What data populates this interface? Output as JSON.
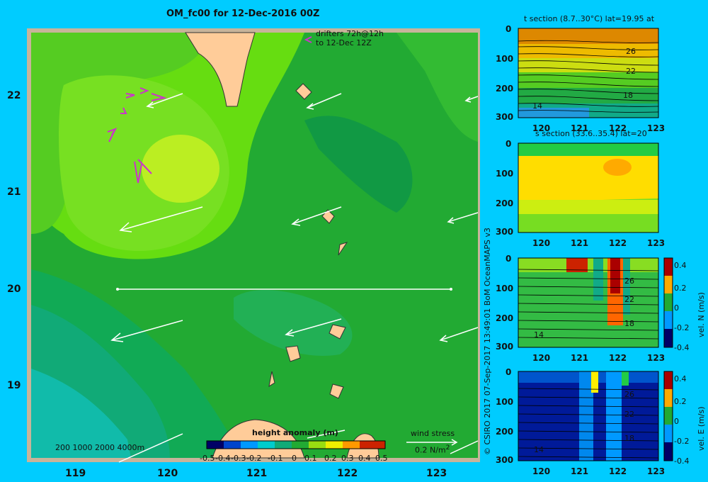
{
  "map": {
    "title": "OM_fc00 for 12-Dec-2016 00Z",
    "lon_ticks": [
      "119",
      "120",
      "121",
      "122",
      "123"
    ],
    "lat_ticks": [
      "22",
      "21",
      "20",
      "19"
    ],
    "drifters_line1": "drifters 72h@12h",
    "drifters_line2": "to 12-Dec 12Z",
    "depth_contours": "200  1000  2000  4000m",
    "wind_stress_label": "wind stress",
    "wind_stress_value": "0.2 N/m",
    "wind_stress_sup": "2",
    "colorbar_title": "height anomaly  (m)",
    "colorbar_ticks": [
      "-0.5",
      "-0.4",
      "-0.3",
      "-0.2",
      "-0.1",
      "0",
      "0.1",
      "0.2",
      "0.3",
      "0.4",
      "0.5"
    ],
    "credit": "© CSIRO 2017   07-Sep-2017 13:49:01 BoM OceanMAPS v3",
    "colors": {
      "background": "#00ccff",
      "land": "#ffcc99",
      "frame": "#c8b49a",
      "drifter": "#cc33cc",
      "arrow": "#ffffff"
    }
  },
  "panels": [
    {
      "title": "t section (8.7..30°C) lat=19.95 at",
      "x_ticks": [
        "120",
        "121",
        "122",
        "123"
      ],
      "y_ticks": [
        "0",
        "100",
        "200",
        "300"
      ],
      "contour_labels": [
        "26",
        "22",
        "18",
        "14"
      ]
    },
    {
      "title": "s section (33.6..35.4) lat=20",
      "x_ticks": [
        "120",
        "121",
        "122",
        "123"
      ],
      "y_ticks": [
        "0",
        "100",
        "200",
        "300"
      ]
    },
    {
      "title": "",
      "x_ticks": [
        "120",
        "121",
        "122",
        "123"
      ],
      "y_ticks": [
        "0",
        "100",
        "200",
        "300"
      ],
      "contour_labels": [
        "26",
        "22",
        "18",
        "14"
      ],
      "cbar_label": "vel. N  (m/s)",
      "cbar_ticks": [
        "0.4",
        "0.2",
        "0",
        "-0.2",
        "-0.4"
      ]
    },
    {
      "title": "",
      "x_ticks": [
        "120",
        "121",
        "122",
        "123"
      ],
      "y_ticks": [
        "0",
        "100",
        "200",
        "300"
      ],
      "contour_labels": [
        "26",
        "22",
        "18",
        "14"
      ],
      "cbar_label": "vel. E  (m/s)",
      "cbar_ticks": [
        "0.4",
        "0.2",
        "0",
        "-0.2",
        "-0.4"
      ]
    }
  ]
}
